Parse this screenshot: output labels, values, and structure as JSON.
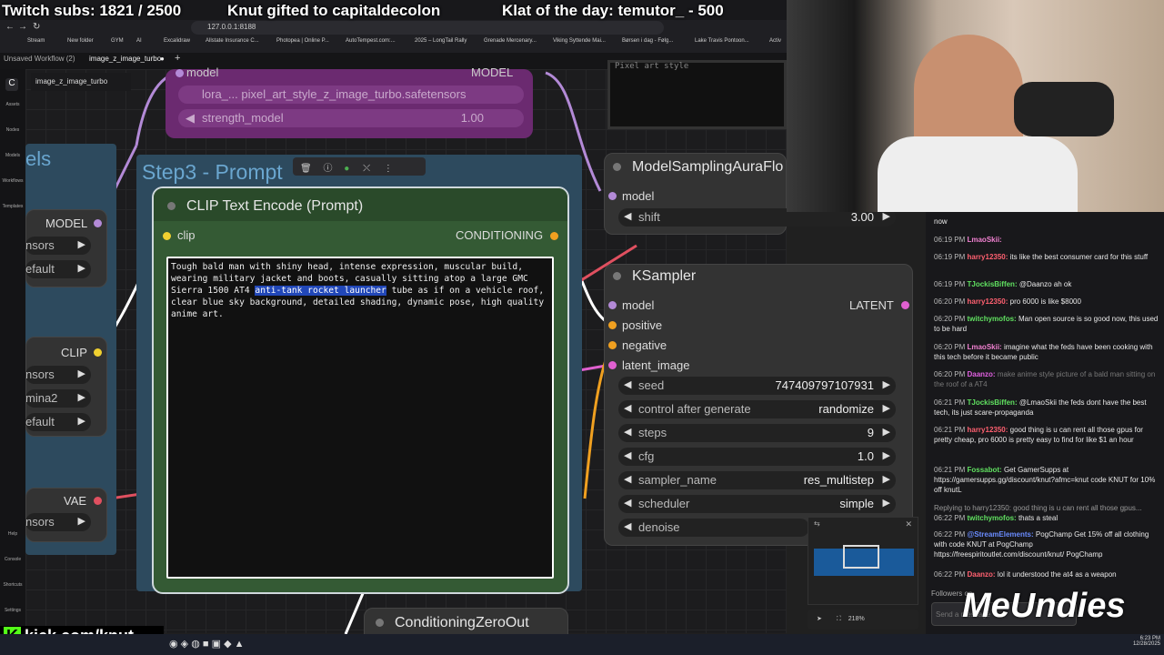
{
  "overlay": {
    "subs": "Twitch subs: 1821 / 2500",
    "gift": "Knut gifted to capitaldecolon",
    "klat": "Klat of the day: temutor_ - 500",
    "kick": "kick.com/knut",
    "sponsor": "MeUndies"
  },
  "browser": {
    "url": "127.0.0.1:8188",
    "bookmarks": [
      "Stream",
      "New folder",
      "GYM",
      "AI",
      "Excalidraw",
      "Allstate Insurance C...",
      "Photopea | Online P...",
      "AutoTempest.com:...",
      "2025 – LongTail Rally",
      "Grenade Mercenary...",
      "Viking Syttende Mai...",
      "Børsen i dag - Følg...",
      "Lake Travis Pontoon...",
      "Activ"
    ]
  },
  "workflow": {
    "tabs": [
      "Unsaved Workflow (2)",
      "image_z_image_turbo"
    ],
    "active_label": "image_z_image_turbo"
  },
  "sidebar": [
    "Assets",
    "Nodes",
    "Models",
    "Workflows",
    "Templates",
    "Help",
    "Console",
    "Shortcuts",
    "Settings"
  ],
  "lora": {
    "input": "model",
    "output": "MODEL",
    "lora_name": "lora_... pixel_art_style_z_image_turbo.safetensors",
    "strength_label": "strength_model",
    "strength_value": "1.00"
  },
  "group": {
    "left_title": "els",
    "step3_title": "Step3 - Prompt"
  },
  "left_node": {
    "model_label": "MODEL",
    "clip_label": "CLIP",
    "vae_label": "VAE",
    "w1": "nsors",
    "w2": "efault",
    "w3": "nsors",
    "w4": "mina2",
    "w5": "efault",
    "w6": "nsors"
  },
  "clip_node": {
    "title": "CLIP Text Encode (Prompt)",
    "input": "clip",
    "output": "CONDITIONING",
    "text_before": "Tough bald man with shiny head, intense expression, muscular build, wearing military jacket and boots, casually sitting atop a large GMC Sierra 1500 AT4 ",
    "text_selected": "anti-tank rocket launcher",
    "text_after": " tube as if on a vehicle roof, clear blue sky background, detailed shading, dynamic pose, high quality anime art."
  },
  "preview_text": "Pixel art style",
  "aura": {
    "title": "ModelSamplingAuraFlo",
    "input": "model",
    "shift_label": "shift",
    "shift_value": "3.00"
  },
  "ksampler": {
    "title": "KSampler",
    "inputs": [
      "model",
      "positive",
      "negative",
      "latent_image"
    ],
    "output": "LATENT",
    "widgets": [
      {
        "label": "seed",
        "value": "747409797107931"
      },
      {
        "label": "control after generate",
        "value": "randomize"
      },
      {
        "label": "steps",
        "value": "9"
      },
      {
        "label": "cfg",
        "value": "1.0"
      },
      {
        "label": "sampler_name",
        "value": "res_multistep"
      },
      {
        "label": "scheduler",
        "value": "simple"
      },
      {
        "label": "denoise",
        "value": ""
      }
    ]
  },
  "zero_node": {
    "title": "ConditioningZeroOut"
  },
  "minimap": {
    "zoom": "218%"
  },
  "chat": {
    "messages": [
      {
        "time": "",
        "user": "",
        "text": "now"
      },
      {
        "time": "06:19 PM",
        "user": "LmaoSkii:",
        "text": ""
      },
      {
        "time": "06:19 PM",
        "user": "harry12350:",
        "text": "its like the best consumer card for this stuff"
      },
      {
        "time": "06:19 PM",
        "user": "TJockisBiffen:",
        "text": "@Daanzo ah ok"
      },
      {
        "time": "06:20 PM",
        "user": "harry12350:",
        "text": "pro 6000 is like $8000"
      },
      {
        "time": "06:20 PM",
        "user": "twitchymofos:",
        "text": "Man open source is so good now, this used to be hard"
      },
      {
        "time": "06:20 PM",
        "user": "LmaoSkii:",
        "text": "imagine what the feds have been cooking with this tech before it became public"
      },
      {
        "time": "06:20 PM",
        "user": "Daanzo:",
        "text": "make anime style picture of a bald man sitting on the roof of a AT4"
      },
      {
        "time": "06:21 PM",
        "user": "TJockisBiffen:",
        "text": "@LmaoSkii the feds dont have the best tech, its just scare-propaganda"
      },
      {
        "time": "06:21 PM",
        "user": "harry12350:",
        "text": "good thing is u can rent all those gpus for pretty cheap, pro 6000 is pretty easy to find for like $1 an hour"
      },
      {
        "time": "06:21 PM",
        "user": "Fossabot:",
        "text": "Get GamerSupps at https://gamersupps.gg/discount/knut?afmc=knut code KNUT for 10% off knutL"
      },
      {
        "time": "",
        "user": "",
        "text": "Replying to harry12350: good thing is u can rent all those gpus..."
      },
      {
        "time": "06:22 PM",
        "user": "twitchymofos:",
        "text": "thats a steal"
      },
      {
        "time": "06:22 PM",
        "user": "@StreamElements:",
        "text": "PogChamp Get 15% off all clothing with code KNUT at PogChamp https://freespiritoutlet.com/discount/knut/ PogChamp"
      },
      {
        "time": "06:22 PM",
        "user": "Daanzo:",
        "text": "lol it understood the at4 as a weapon"
      }
    ],
    "followers": "Followers on",
    "send_placeholder": "Send a message"
  },
  "clock": {
    "time": "6:23 PM",
    "date": "12/28/2025"
  },
  "colors": {
    "accent": "#2147b8",
    "lora": "#6b2a70",
    "group": "#3a6a86",
    "clipbody": "#345a34"
  }
}
